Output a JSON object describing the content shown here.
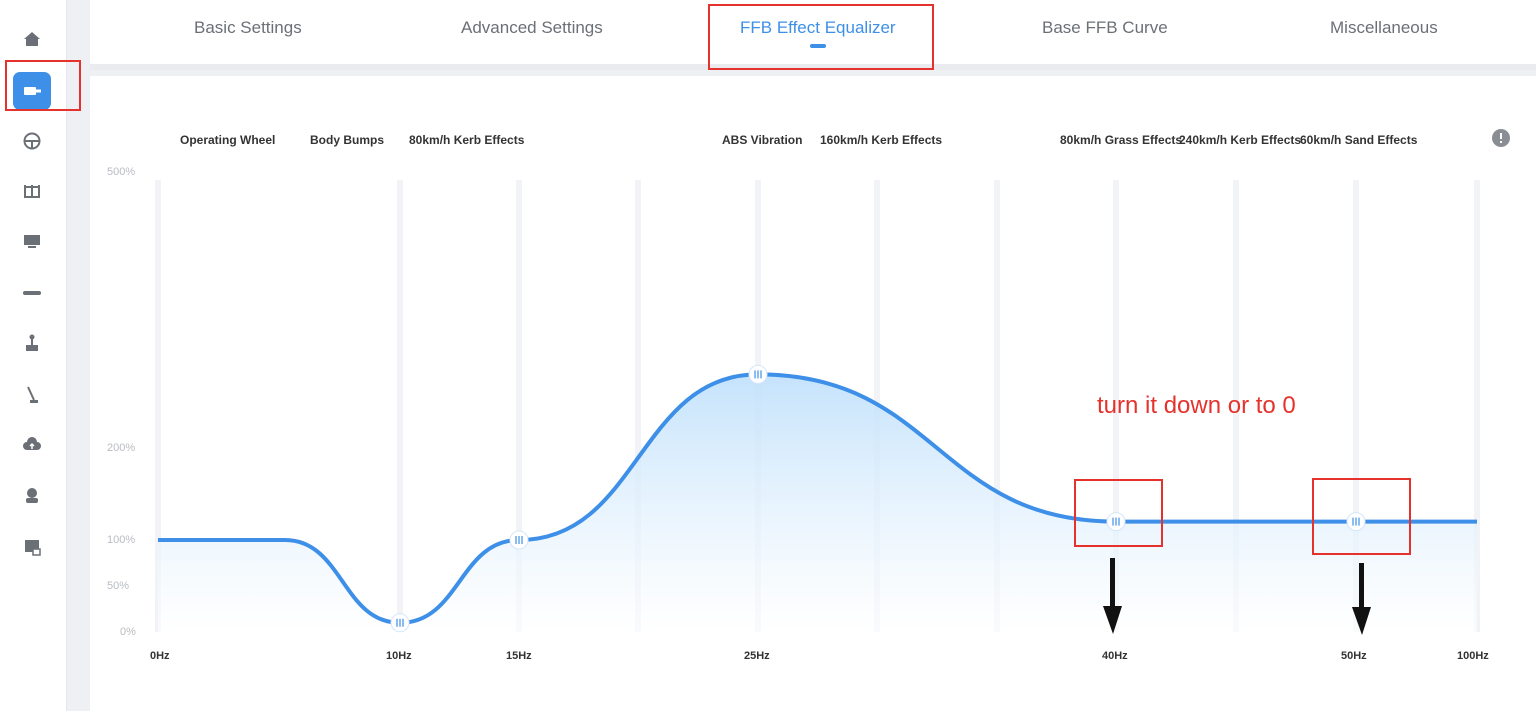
{
  "tabs": [
    {
      "label": "Basic Settings"
    },
    {
      "label": "Advanced Settings"
    },
    {
      "label": "FFB Effect Equalizer"
    },
    {
      "label": "Base FFB Curve"
    },
    {
      "label": "Miscellaneous"
    }
  ],
  "active_tab": "FFB Effect Equalizer",
  "sidebar": {
    "icons": [
      "home-icon",
      "wheelbase-icon",
      "steering-wheel-icon",
      "pedals-icon",
      "dashboard-icon",
      "handbrake-icon",
      "shifter-icon",
      "lever-icon",
      "cloud-icon",
      "user-icon",
      "support-icon"
    ],
    "active": "wheelbase-icon"
  },
  "effect_labels": [
    "Operating Wheel",
    "Body Bumps",
    "80km/h Kerb Effects",
    "ABS Vibration",
    "160km/h Kerb Effects",
    "80km/h Grass Effects",
    "240km/h Kerb Effects",
    "60km/h Sand Effects"
  ],
  "annotation": {
    "text": "turn it down or to 0",
    "color": "#e5322d"
  },
  "colors": {
    "accent": "#3d8fe8",
    "annotation": "#e5322d"
  },
  "chart_data": {
    "type": "area",
    "y_tick_labels": [
      "500%",
      "200%",
      "100%",
      "50%",
      "0%"
    ],
    "x": [
      "0Hz",
      "10Hz",
      "15Hz",
      "25Hz",
      "40Hz",
      "50Hz",
      "100Hz"
    ],
    "values": [
      100,
      10,
      100,
      280,
      120,
      120,
      120
    ],
    "ylim": [
      0,
      500
    ],
    "grid": true
  }
}
